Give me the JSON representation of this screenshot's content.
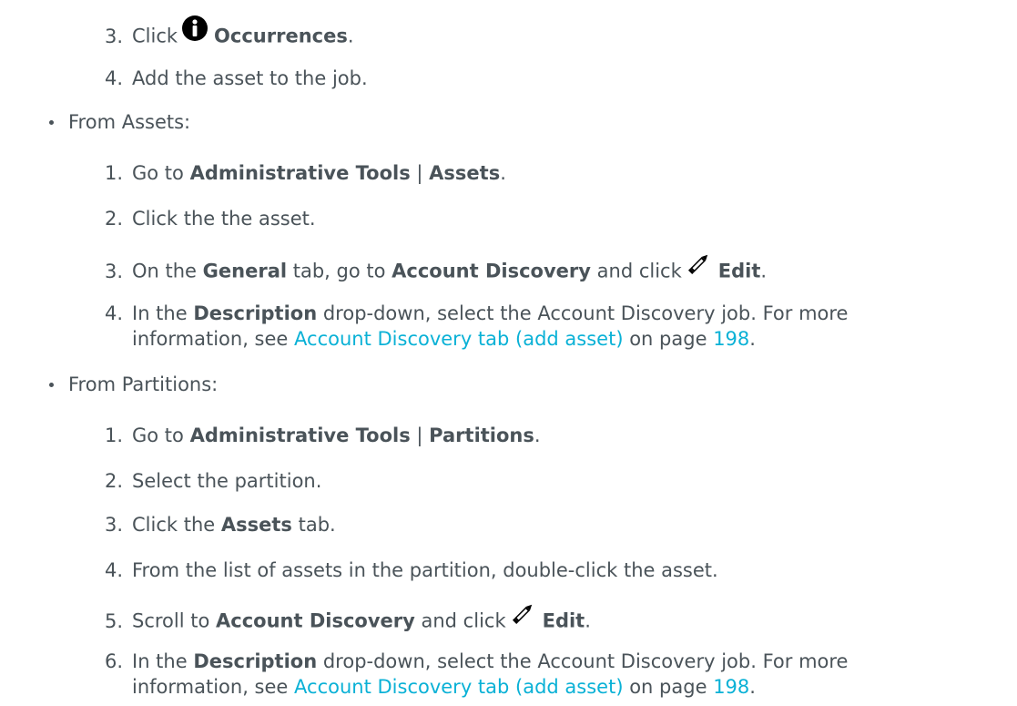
{
  "asset_occurrences": {
    "s3": {
      "num": "3.",
      "t1": "Click",
      "b1": "Occurrences",
      "t2": "."
    },
    "s4": {
      "num": "4.",
      "t1": "Add the asset to the job."
    }
  },
  "from_assets": {
    "label": "From Assets:",
    "s1": {
      "num": "1.",
      "t1": "Go to",
      "b1": "Administrative Tools",
      "t2": " | ",
      "b2": "Assets",
      "t3": "."
    },
    "s2": {
      "num": "2.",
      "t1": "Click the the asset."
    },
    "s3": {
      "num": "3.",
      "t1": "On the",
      "b1": "General",
      "t2": " tab, go to ",
      "b2": "Account Discovery",
      "t3": " and click",
      "b3": "Edit",
      "t4": "."
    },
    "s4": {
      "num": "4.",
      "t1": "In the",
      "b1": "Description",
      "t2": " drop-down, select the Account Discovery job. For more",
      "t3": "information, see",
      "link": "Account Discovery tab (add asset)",
      "t4": " on page",
      "page": "198",
      "t5": "."
    }
  },
  "from_partitions": {
    "label": "From Partitions:",
    "s1": {
      "num": "1.",
      "t1": "Go to",
      "b1": "Administrative Tools",
      "t2": " | ",
      "b2": "Partitions",
      "t3": "."
    },
    "s2": {
      "num": "2.",
      "t1": "Select the partition."
    },
    "s3": {
      "num": "3.",
      "t1": "Click the",
      "b1": "Assets",
      "t2": " tab."
    },
    "s4": {
      "num": "4.",
      "t1": "From the list of assets in the partition, double-click the asset."
    },
    "s5": {
      "num": "5.",
      "t1": "Scroll to",
      "b1": "Account Discovery",
      "t2": " and click",
      "b2": "Edit",
      "t3": "."
    },
    "s6": {
      "num": "6.",
      "t1": "In the",
      "b1": "Description",
      "t2": " drop-down, select the Account Discovery job. For more",
      "t3": "information, see",
      "link": "Account Discovery tab (add asset)",
      "t4": " on page",
      "page": "198",
      "t5": "."
    }
  },
  "icons": {
    "info": "info-circle-icon",
    "edit": "pencil-icon"
  }
}
